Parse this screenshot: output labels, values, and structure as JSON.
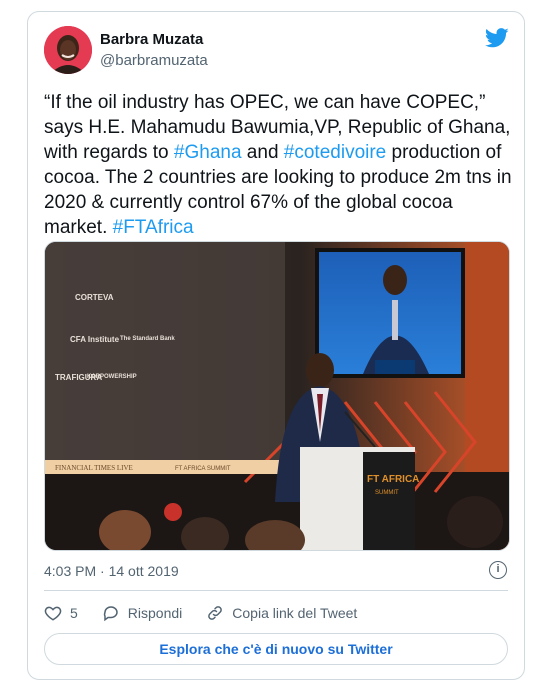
{
  "tweet": {
    "author_name": "Barbra Muzata",
    "author_handle": "@barbramuzata",
    "text_parts": {
      "p1": "“If the oil industry has OPEC, we can have COPEC,” says H.E. Mahamudu Bawumia,VP, Republic of Ghana, with regards to ",
      "h1": "#Ghana",
      "p2": " and ",
      "h2": "#cotedivoire",
      "p3": " production of cocoa. The 2 countries are looking to produce 2m tns in 2020 & currently control 67% of the global cocoa market. ",
      "h3": "#FTAfrica"
    },
    "timestamp": "4:03 PM · 14 ott 2019",
    "likes_count": "5",
    "reply_label": "Rispondi",
    "copy_link_label": "Copia link del Tweet",
    "explore_label": "Esplora che c'è di nuovo su Twitter"
  },
  "photo": {
    "sponsors": [
      "CORTEVA",
      "CFA Institute",
      "TRAFIGURA",
      "KARPOWERSHIP",
      "The Standard Bank"
    ],
    "banner_left": "FINANCIAL TIMES LIVE",
    "banner_mid": "FT AFRICA SUMMIT",
    "podium_text": "FT AFRICA",
    "podium_sub": "SUMMIT"
  },
  "colors": {
    "accent": "#1d9bf0",
    "link_button": "#1d6fd8",
    "muted": "#536471",
    "border": "#cfd9de"
  },
  "icons": {
    "bird": "twitter-bird-icon",
    "like": "heart-icon",
    "reply": "speech-bubble-icon",
    "copy": "link-icon",
    "info": "info-icon"
  }
}
